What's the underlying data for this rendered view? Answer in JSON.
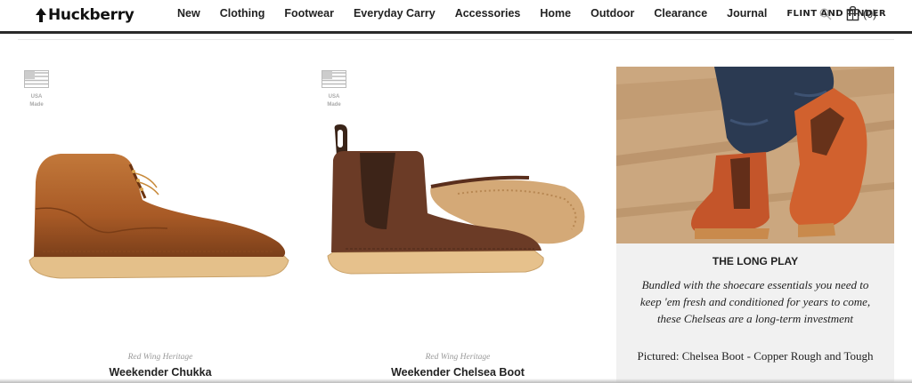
{
  "header": {
    "logo_text": "Huckberry",
    "nav": [
      "New",
      "Clothing",
      "Footwear",
      "Everyday Carry",
      "Accessories",
      "Home",
      "Outdoor",
      "Clearance",
      "Journal",
      "FLINT AND TINDER"
    ],
    "cart_count": "(0)"
  },
  "products": [
    {
      "badge": [
        "USA",
        "Made"
      ],
      "brand": "Red Wing Heritage",
      "name": "Weekender Chukka"
    },
    {
      "badge": [
        "USA",
        "Made"
      ],
      "brand": "Red Wing Heritage",
      "name": "Weekender Chelsea Boot"
    }
  ],
  "editorial": {
    "title": "THE LONG PLAY",
    "body": "Bundled with the shoecare essentials you need to keep 'em fresh and conditioned for years to come, these Chelseas are a long-term investment",
    "pictured": "Pictured: Chelsea Boot - Copper Rough and Tough"
  },
  "colors": {
    "header_rule": "#2a2a2a",
    "editorial_bg": "#f1f1f1",
    "leather_copper": "#b5652b",
    "leather_brown": "#6a3a26",
    "sole": "#e7c48e"
  }
}
